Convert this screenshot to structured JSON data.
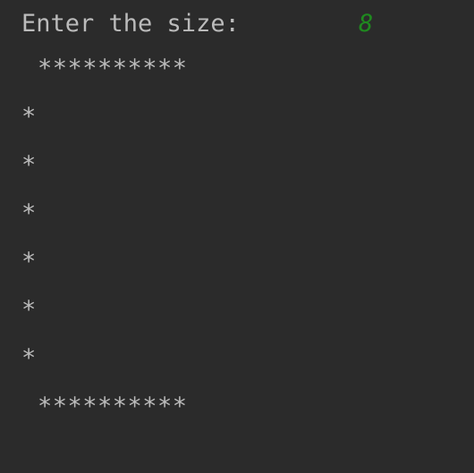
{
  "console": {
    "prompt": "Enter the size:",
    "user_input": "8",
    "input_color": "#1f8a1f",
    "text_color": "#bbbbbb",
    "background": "#2b2b2b",
    "output_lines": [
      "**********",
      "*",
      "*",
      "*",
      "*",
      "*",
      "*",
      "**********"
    ]
  }
}
